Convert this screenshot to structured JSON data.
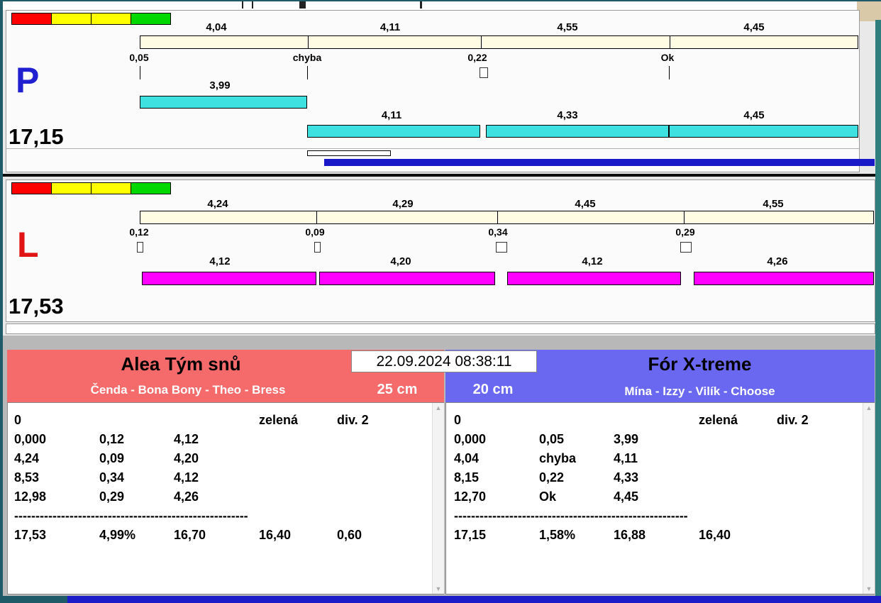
{
  "icons": {
    "scroll_up": "▲",
    "scroll_down": "▼"
  },
  "colors": {
    "status_red": "#ff0000",
    "status_yellow": "#ffff00",
    "status_green": "#00d800",
    "lane_p_accent": "#2020d0",
    "lane_l_accent": "#e01414",
    "split_bar": "#fffce3",
    "leg_bar_p": "#3fe0e0",
    "leg_bar_l": "#ff00ff",
    "progress_bar": "#1818c8",
    "team_left_header": "#f56a6a",
    "team_right_header": "#6a68f0",
    "frame_teal": "#1e5a68",
    "bottom_strip_blue": "#1c1cc8"
  },
  "lane_p": {
    "label": "P",
    "total": "17,15",
    "splits": [
      "4,04",
      "4,11",
      "4,55",
      "4,45"
    ],
    "markers": [
      "0,05",
      "chyba",
      "0,22",
      "Ok"
    ],
    "first_leg": "3,99",
    "legs": [
      "4,11",
      "4,33",
      "4,45"
    ]
  },
  "lane_l": {
    "label": "L",
    "total": "17,53",
    "splits": [
      "4,24",
      "4,29",
      "4,45",
      "4,55"
    ],
    "markers": [
      "0,12",
      "0,09",
      "0,34",
      "0,29"
    ],
    "legs": [
      "4,12",
      "4,20",
      "4,12",
      "4,26"
    ]
  },
  "timestamp": "22.09.2024 08:38:11",
  "teams": {
    "left": {
      "name": "Alea Tým snů",
      "members": "Čenda - Bona Bony - Theo - Bress",
      "handicap": "25 cm",
      "rows": [
        [
          "0",
          "",
          "",
          "zelená",
          "div. 2"
        ],
        [
          "0,000",
          "0,12",
          "4,12",
          "",
          ""
        ],
        [
          "4,24",
          "0,09",
          "4,20",
          "",
          ""
        ],
        [
          "8,53",
          "0,34",
          "4,12",
          "",
          ""
        ],
        [
          "12,98",
          "0,29",
          "4,26",
          "",
          ""
        ],
        [
          "-------------------------------------------------------",
          "",
          "",
          "",
          ""
        ],
        [
          "17,53",
          "4,99%",
          "16,70",
          "16,40",
          "0,60"
        ]
      ]
    },
    "right": {
      "name": "Fór X-treme",
      "members": "Mína - Izzy - Vilík - Choose",
      "handicap": "20 cm",
      "rows": [
        [
          "0",
          "",
          "",
          "zelená",
          "div. 2"
        ],
        [
          "0,000",
          "0,05",
          "3,99",
          "",
          ""
        ],
        [
          "4,04",
          "chyba",
          "4,11",
          "",
          ""
        ],
        [
          "8,15",
          "0,22",
          "4,33",
          "",
          ""
        ],
        [
          "12,70",
          "Ok",
          "4,45",
          "",
          ""
        ],
        [
          "-------------------------------------------------------",
          "",
          "",
          "",
          ""
        ],
        [
          "17,15",
          "1,58%",
          "16,88",
          "16,40",
          ""
        ]
      ]
    }
  }
}
